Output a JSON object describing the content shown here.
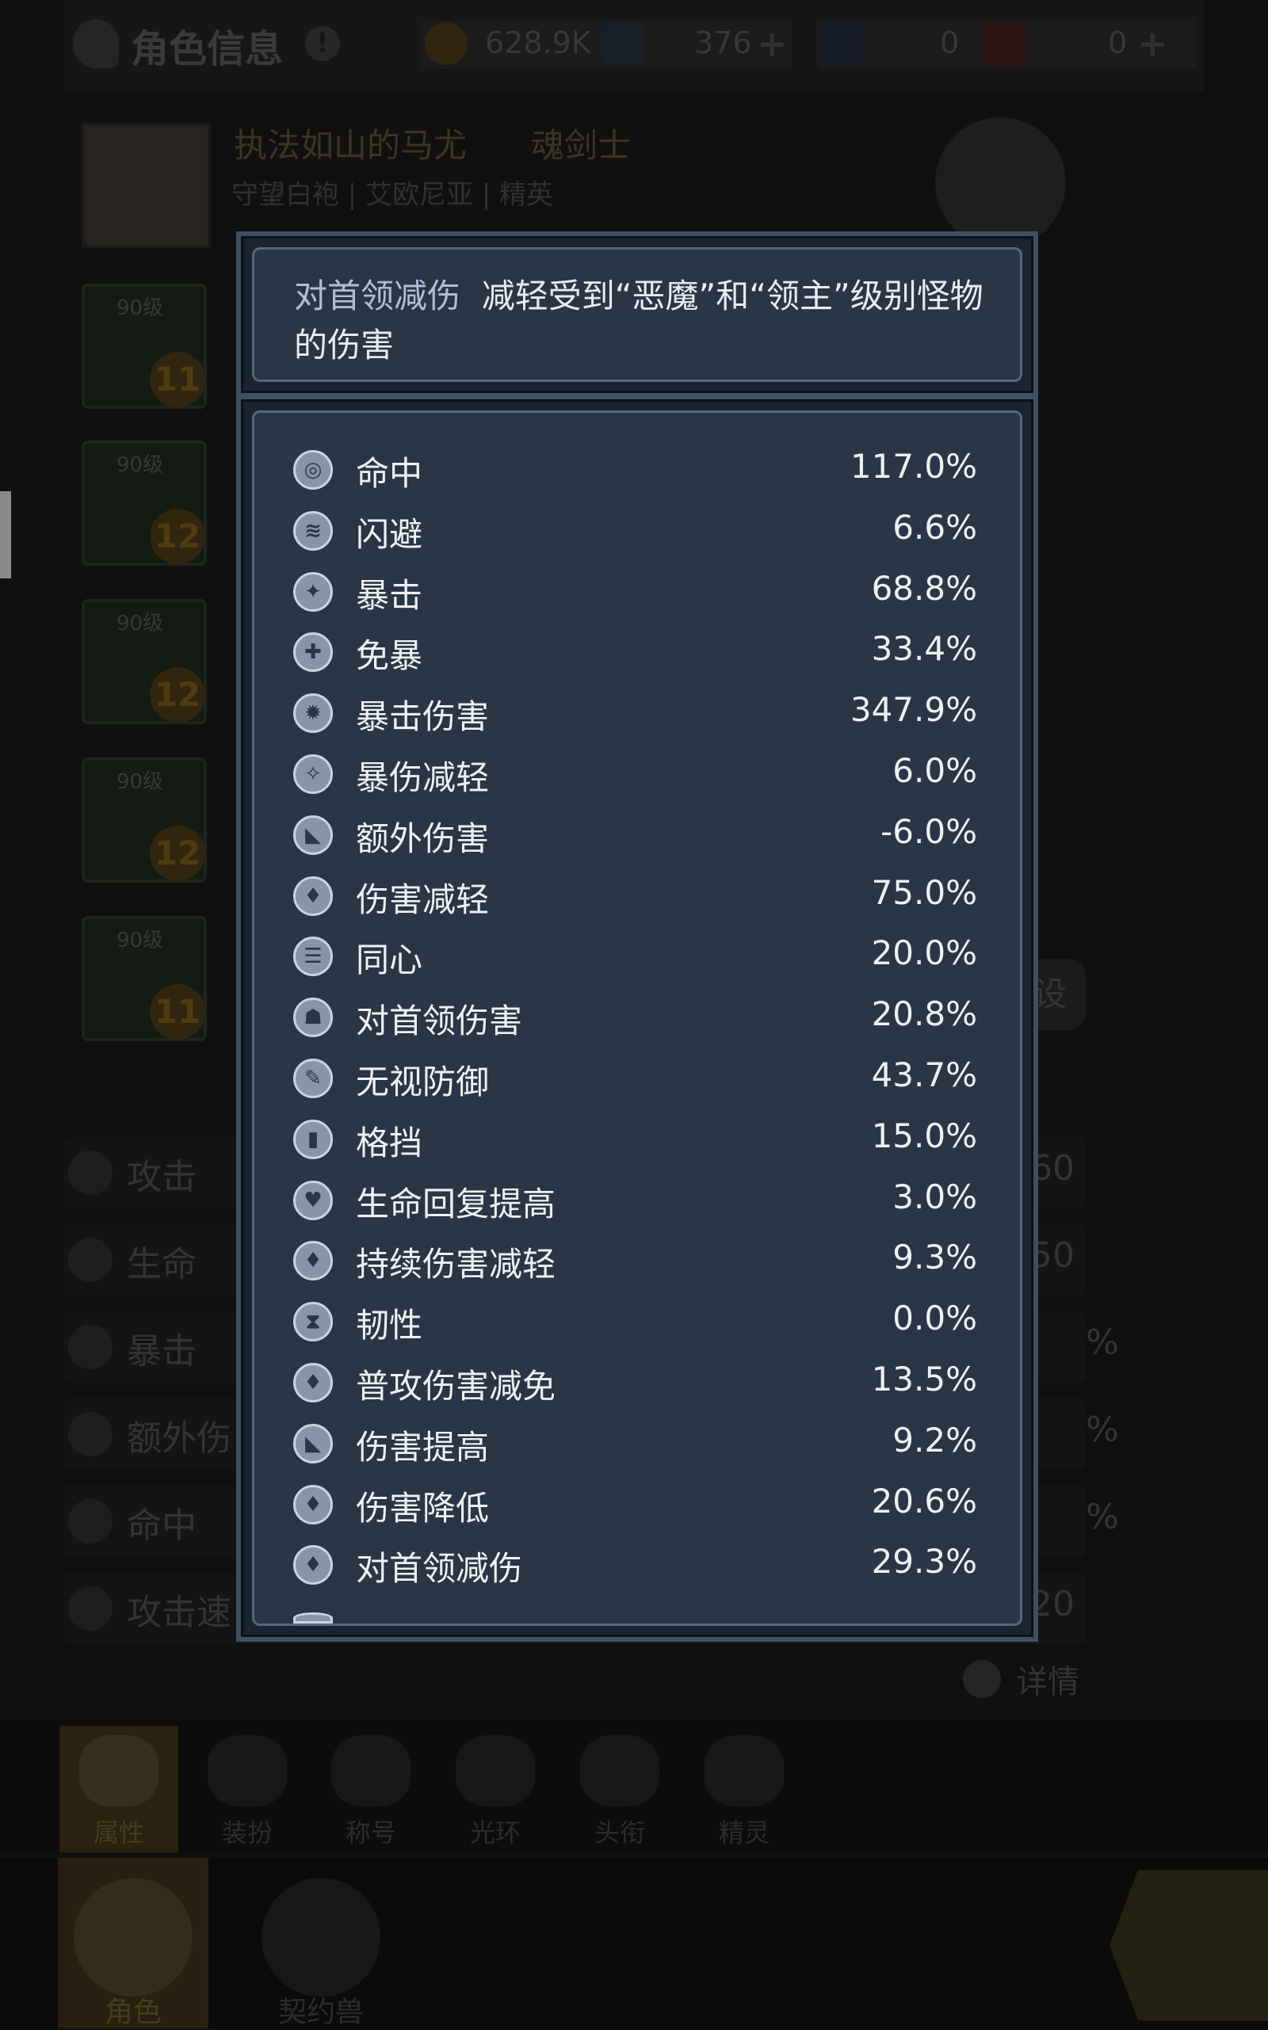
{
  "header": {
    "title": "角色信息",
    "currency": [
      {
        "name": "gold-coin",
        "value": "628.9K"
      },
      {
        "name": "crystal",
        "value": "376"
      },
      {
        "name": "card-a",
        "value": "0"
      },
      {
        "name": "card-b",
        "value": "0"
      }
    ]
  },
  "character": {
    "name": "执法如山的马尤",
    "class": "魂剑士",
    "subtitle": "守望白袍 | 艾欧尼亚 | 精英"
  },
  "equipment": [
    {
      "level": "90级",
      "badge": "11"
    },
    {
      "level": "90级",
      "badge": "12"
    },
    {
      "level": "90级",
      "badge": "12"
    },
    {
      "level": "90级",
      "badge": "12"
    },
    {
      "level": "90级",
      "badge": "11"
    }
  ],
  "base_stats": [
    {
      "label": "攻击",
      "value": "60"
    },
    {
      "label": "生命",
      "value": "50"
    },
    {
      "label": "暴击",
      "value": "%"
    },
    {
      "label": "额外伤",
      "value": "%"
    },
    {
      "label": "命中",
      "value": "%"
    },
    {
      "label": "攻击速",
      "value": "20"
    }
  ],
  "detail_label": "详情",
  "side_button_label": "设",
  "tabs": [
    "属性",
    "装扮",
    "称号",
    "光环",
    "头衔",
    "精灵"
  ],
  "bottom_nav": [
    "角色",
    "契约兽"
  ],
  "tooltip": {
    "key": "对首领减伤",
    "text": "减轻受到“恶魔”和“领主”级别怪物的伤害"
  },
  "attributes": [
    {
      "icon": "target-icon",
      "label": "命中",
      "value": "117.0%"
    },
    {
      "icon": "dodge-icon",
      "label": "闪避",
      "value": "6.6%"
    },
    {
      "icon": "crit-icon",
      "label": "暴击",
      "value": "68.8%"
    },
    {
      "icon": "crit-resist-icon",
      "label": "免暴",
      "value": "33.4%"
    },
    {
      "icon": "crit-damage-icon",
      "label": "暴击伤害",
      "value": "347.9%"
    },
    {
      "icon": "crit-damage-reduce-icon",
      "label": "暴伤减轻",
      "value": "6.0%"
    },
    {
      "icon": "extra-damage-icon",
      "label": "额外伤害",
      "value": "-6.0%"
    },
    {
      "icon": "damage-reduce-icon",
      "label": "伤害减轻",
      "value": "75.0%"
    },
    {
      "icon": "unity-icon",
      "label": "同心",
      "value": "20.0%"
    },
    {
      "icon": "boss-damage-icon",
      "label": "对首领伤害",
      "value": "20.8%"
    },
    {
      "icon": "ignore-defense-icon",
      "label": "无视防御",
      "value": "43.7%"
    },
    {
      "icon": "block-icon",
      "label": "格挡",
      "value": "15.0%"
    },
    {
      "icon": "regen-icon",
      "label": "生命回复提高",
      "value": "3.0%"
    },
    {
      "icon": "dot-reduce-icon",
      "label": "持续伤害减轻",
      "value": "9.3%"
    },
    {
      "icon": "toughness-icon",
      "label": "韧性",
      "value": "0.0%"
    },
    {
      "icon": "normal-attack-reduce-icon",
      "label": "普攻伤害减免",
      "value": "13.5%"
    },
    {
      "icon": "damage-up-icon",
      "label": "伤害提高",
      "value": "9.2%"
    },
    {
      "icon": "damage-down-icon",
      "label": "伤害降低",
      "value": "20.6%"
    },
    {
      "icon": "boss-damage-reduce-icon",
      "label": "对首领减伤",
      "value": "29.3%"
    }
  ]
}
